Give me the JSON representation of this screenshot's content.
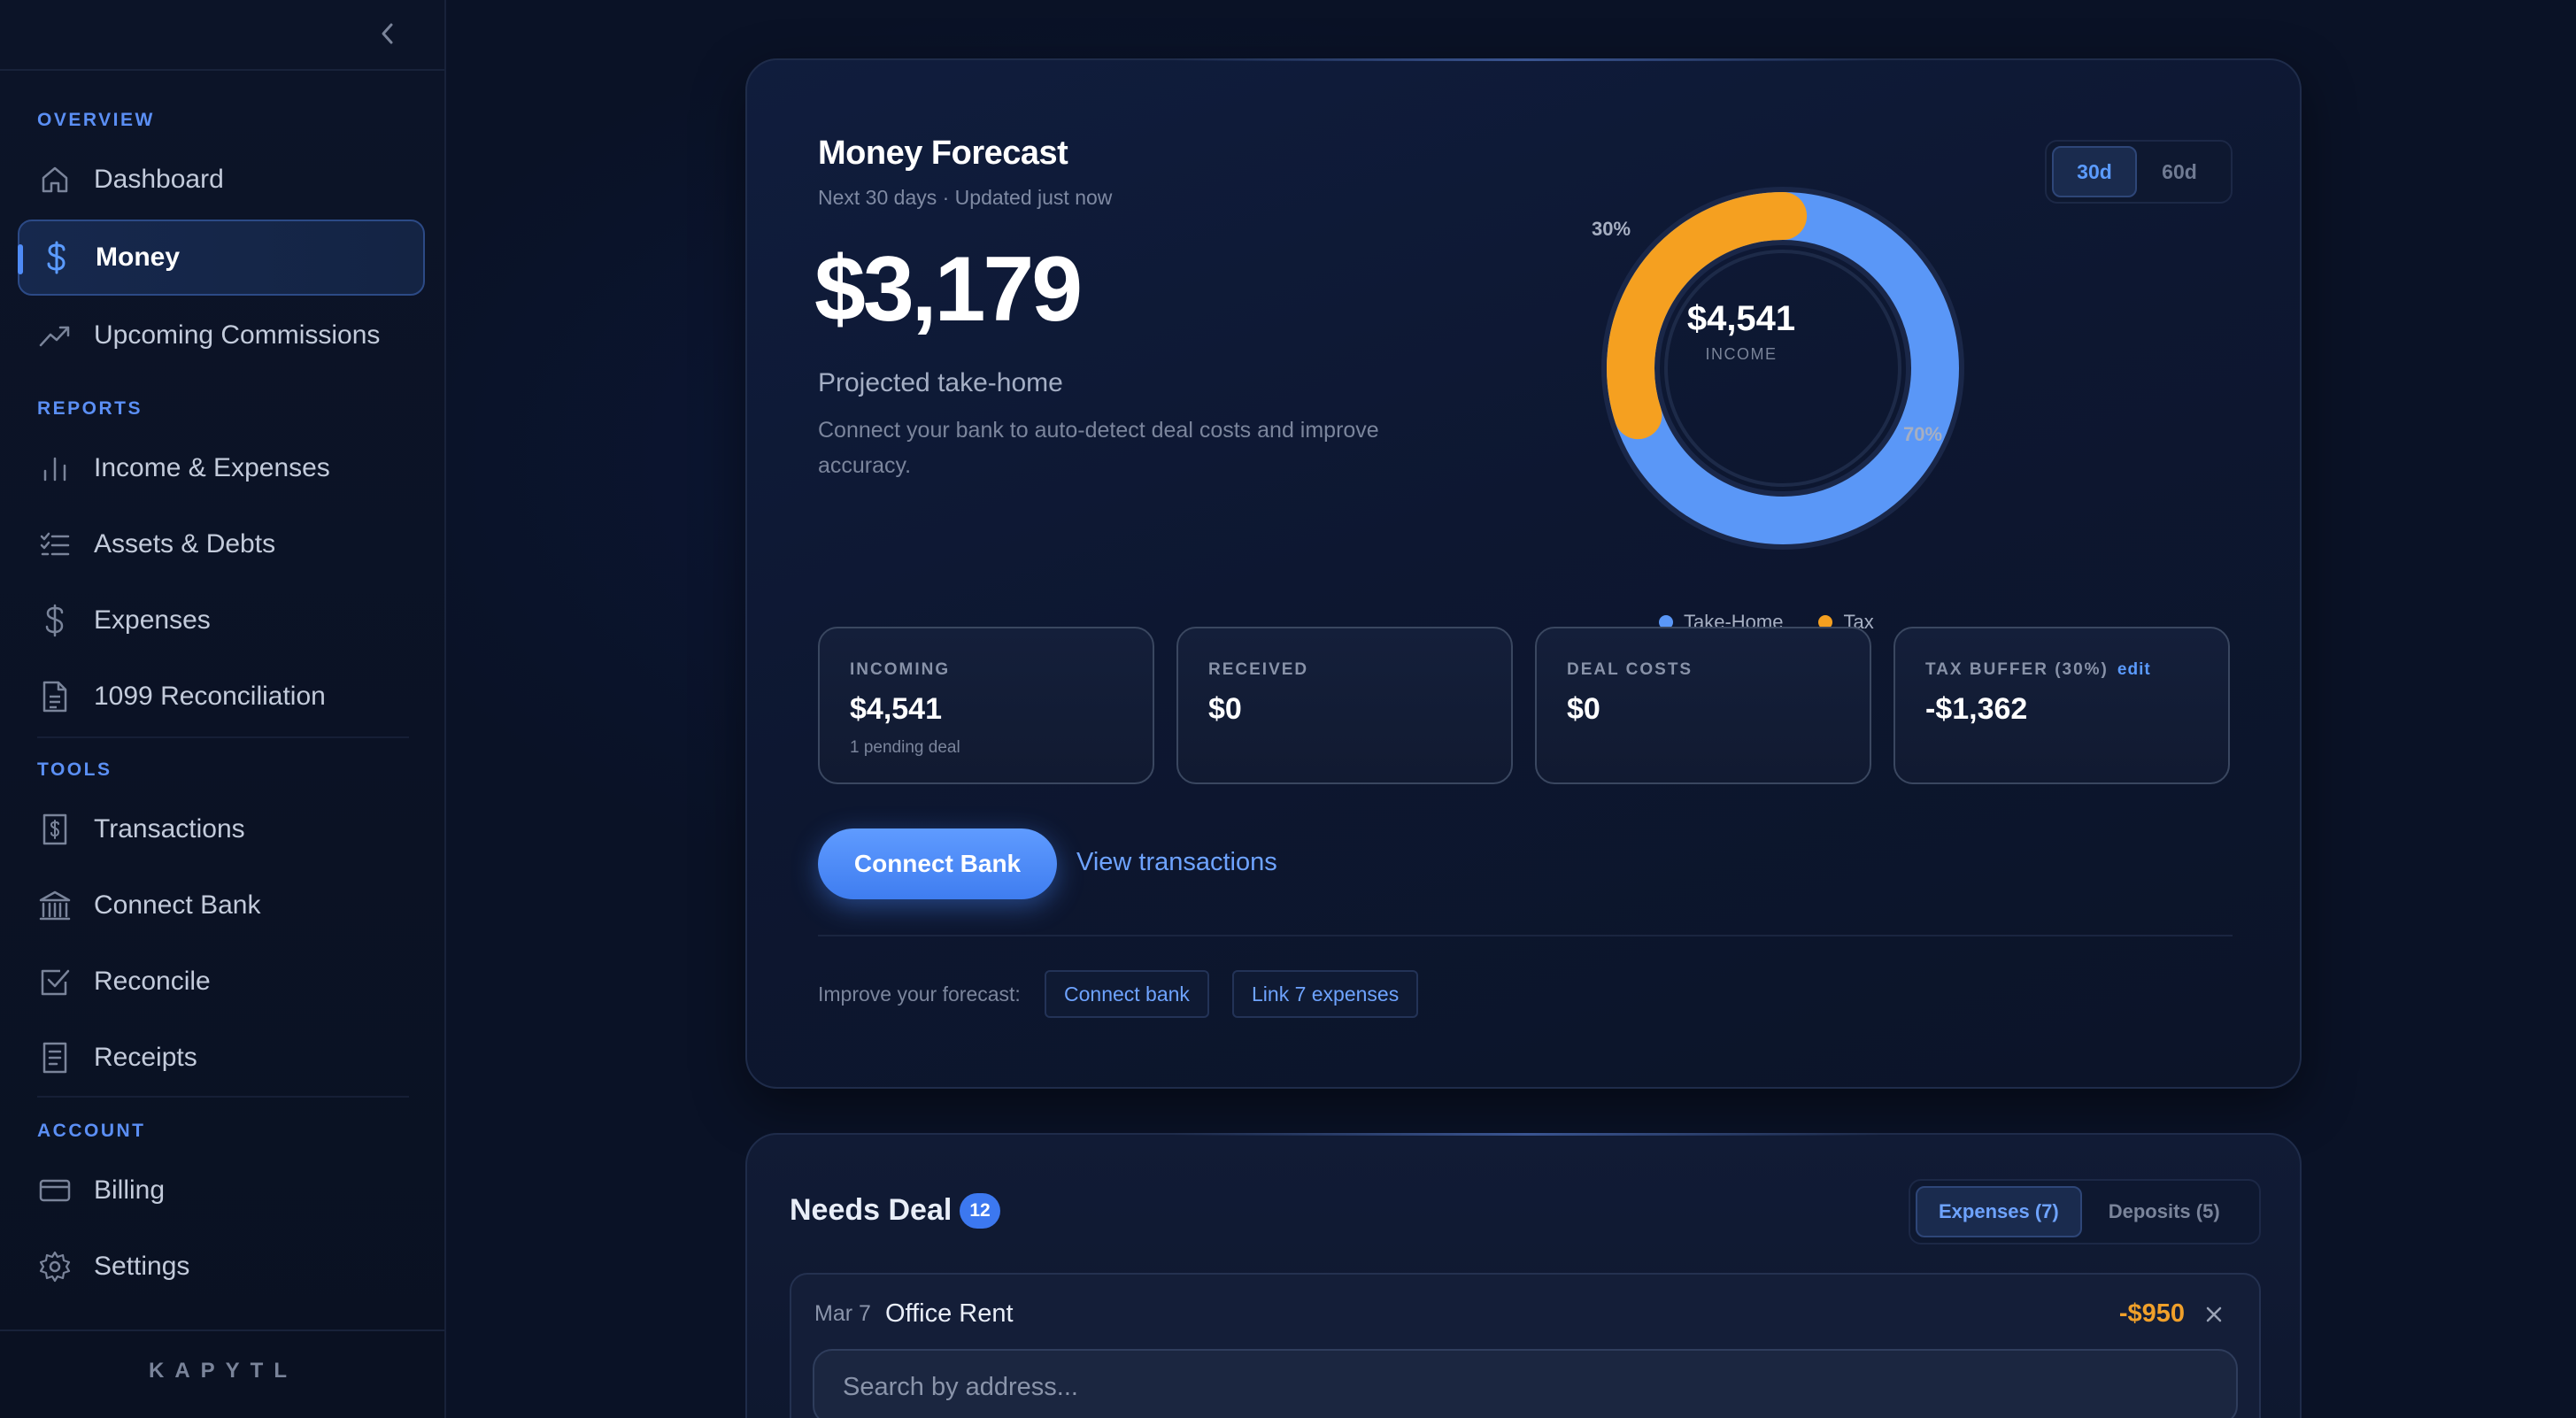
{
  "sidebar": {
    "sections": [
      {
        "label": "OVERVIEW"
      },
      {
        "label": "REPORTS"
      },
      {
        "label": "TOOLS"
      },
      {
        "label": "ACCOUNT"
      }
    ],
    "items": [
      {
        "label": "Dashboard",
        "icon": "home-icon"
      },
      {
        "label": "Money",
        "icon": "dollar-icon",
        "active": true
      },
      {
        "label": "Upcoming Commissions",
        "icon": "trending-up-icon"
      },
      {
        "label": "Income & Expenses",
        "icon": "bar-chart-icon"
      },
      {
        "label": "Assets & Debts",
        "icon": "checklist-icon"
      },
      {
        "label": "Expenses",
        "icon": "dollar-icon"
      },
      {
        "label": "1099 Reconciliation",
        "icon": "document-icon"
      },
      {
        "label": "Transactions",
        "icon": "receipt-dollar-icon"
      },
      {
        "label": "Connect Bank",
        "icon": "bank-icon"
      },
      {
        "label": "Reconcile",
        "icon": "check-square-icon"
      },
      {
        "label": "Receipts",
        "icon": "receipt-icon"
      },
      {
        "label": "Billing",
        "icon": "credit-card-icon"
      },
      {
        "label": "Settings",
        "icon": "gear-icon"
      }
    ],
    "brand": "KAPYTL"
  },
  "forecast": {
    "title": "Money Forecast",
    "subtitle": "Next 30 days · Updated just now",
    "amount": "$3,179",
    "amount_label": "Projected take-home",
    "hint": "Connect your bank to auto-detect deal costs and improve accuracy.",
    "periods": [
      "30d",
      "60d"
    ],
    "selected_period": "30d",
    "donut": {
      "center_amount": "$4,541",
      "center_label": "INCOME",
      "slices": [
        {
          "name": "Take-Home",
          "value": 70,
          "label": "70%",
          "color": "#5a97f7"
        },
        {
          "name": "Tax",
          "value": 30,
          "label": "30%",
          "color": "#f5a020"
        }
      ]
    },
    "stats": [
      {
        "label": "INCOMING",
        "value": "$4,541",
        "note": "1 pending deal"
      },
      {
        "label": "RECEIVED",
        "value": "$0",
        "note": ""
      },
      {
        "label": "DEAL COSTS",
        "value": "$0",
        "note": ""
      },
      {
        "label": "TAX BUFFER (30%)",
        "edit": "edit",
        "value": "-$1,362",
        "note": ""
      }
    ],
    "connect_button": "Connect Bank",
    "view_link": "View transactions",
    "improve_label": "Improve your forecast:",
    "chips": [
      "Connect bank",
      "Link 7 expenses"
    ]
  },
  "needs_deal": {
    "title": "Needs Deal",
    "count": "12",
    "tabs": [
      {
        "label": "Expenses (7)",
        "active": true
      },
      {
        "label": "Deposits (5)",
        "active": false
      }
    ],
    "row": {
      "date": "Mar 7",
      "name": "Office Rent",
      "amount": "-$950"
    },
    "search_placeholder": "Search by address..."
  },
  "colors": {
    "accent": "#4f8bf7",
    "tax": "#f5a020",
    "take_home": "#5a97f7"
  }
}
